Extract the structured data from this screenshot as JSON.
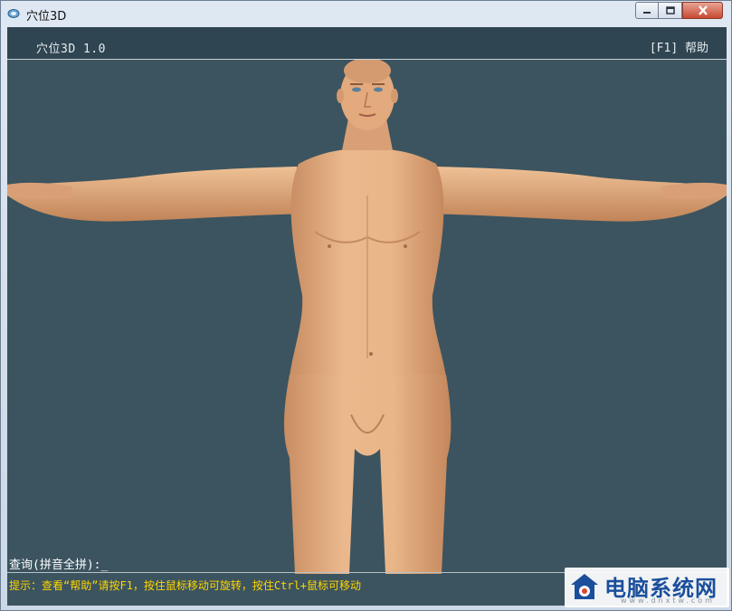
{
  "window": {
    "title": "穴位3D"
  },
  "header": {
    "app_name": "穴位3D 1.0",
    "help": "[F1] 帮助"
  },
  "query": {
    "label": "查询(拼音全拼):_"
  },
  "hint": {
    "text": "提示：查看“帮助”请按F1，按住鼠标移动可旋转，按住Ctrl+鼠标可移动"
  },
  "watermark": {
    "title": "电脑系统网",
    "url": "www.dnxtw.com"
  },
  "colors": {
    "viewport_bg": "#3c545f",
    "header_bg": "#2f4551",
    "hint_text": "#ffd500",
    "skin": "#e2a97c"
  },
  "icons": [
    "app-icon",
    "minimize-icon",
    "maximize-icon",
    "close-icon",
    "house-logo-icon"
  ]
}
